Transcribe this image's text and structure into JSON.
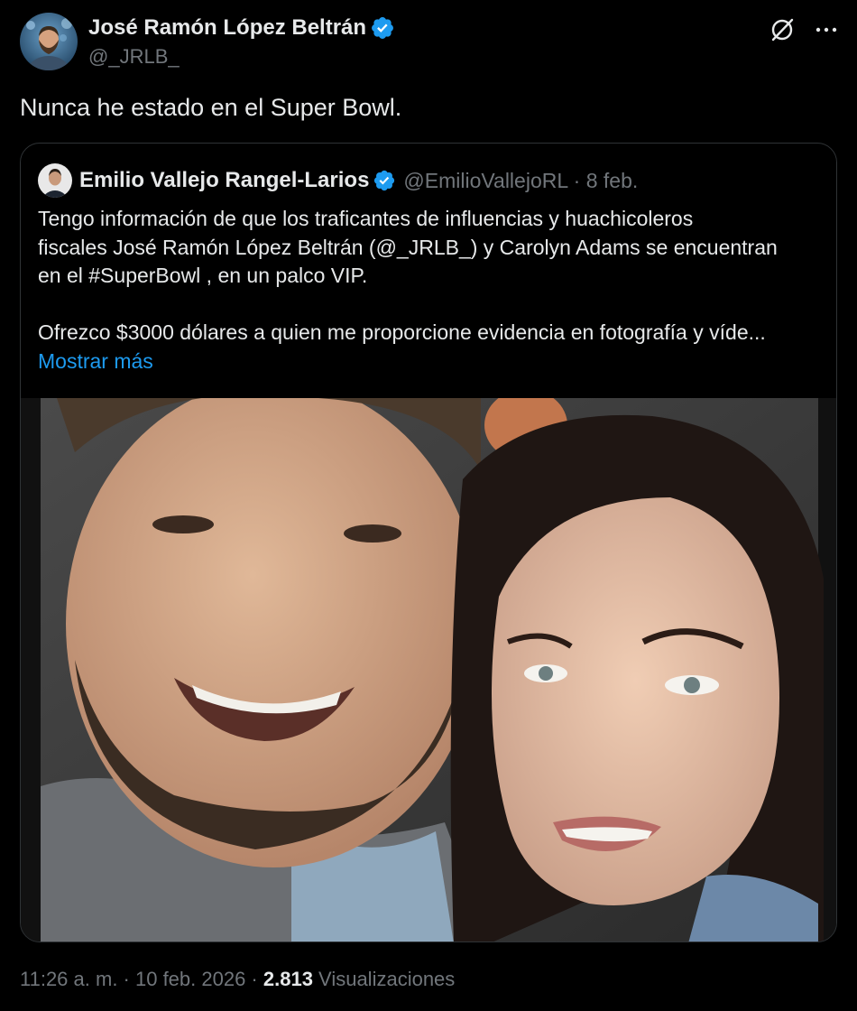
{
  "author": {
    "name": "José Ramón López Beltrán",
    "handle": "@_JRLB_",
    "avatar_icon": "person-avatar",
    "verified": true
  },
  "tweet": {
    "text": "Nunca he estado en el Super Bowl."
  },
  "quote": {
    "author_name": "Emilio Vallejo Rangel-Larios",
    "meta": "@EmilioVallejoRL · 8 feb.",
    "verified": true,
    "lines": [
      "Tengo información de que los traficantes de influencias y huachicoleros",
      "fiscales José Ramón López Beltrán (@_JRLB_) y Carolyn Adams se encuentran",
      "en el #SuperBowl , en un palco VIP."
    ],
    "line4": "Ofrezco $3000 dólares a quien me proporcione evidencia en fotografía y víde...",
    "show_more": "Mostrar más",
    "image_alt": "selfie-photo"
  },
  "footer": {
    "time_date": "11:26 a. m. · 10 feb. 2026 · ",
    "views_count": "2.813",
    "views_label": " Visualizaciones"
  },
  "colors": {
    "background": "#000000",
    "text": "#e7e9ea",
    "muted": "#71767b",
    "link": "#1d9bf0",
    "verified_badge": "#1d9bf0",
    "border": "#2f3336"
  },
  "icons": [
    "grok-icon",
    "more-icon",
    "verified-icon"
  ]
}
